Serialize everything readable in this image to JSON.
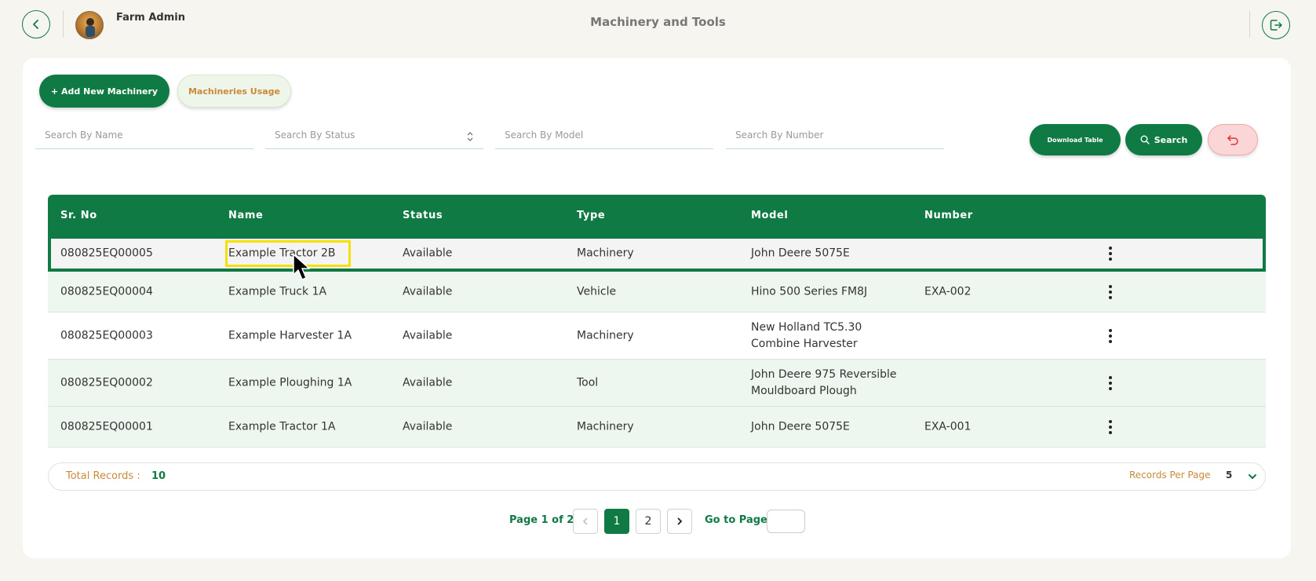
{
  "header": {
    "admin_name": "Farm Admin",
    "title": "Machinery and Tools",
    "back_icon": "chevron-left-icon",
    "logout_icon": "logout-icon"
  },
  "toolbar": {
    "add_label": "+ Add New Machinery",
    "usage_label": "Machineries Usage",
    "download_label": "Download Table",
    "search_label": "Search",
    "reset_icon": "undo-icon"
  },
  "filters": {
    "name_placeholder": "Search By Name",
    "status_placeholder": "Search By Status",
    "model_placeholder": "Search By Model",
    "number_placeholder": "Search By Number"
  },
  "table": {
    "headers": [
      "Sr. No",
      "Name",
      "Status",
      "Type",
      "Model",
      "Number"
    ],
    "rows": [
      {
        "sr": "080825EQ00005",
        "name": "Example Tractor 2B",
        "status": "Available",
        "type": "Machinery",
        "model": "John Deere 5075E",
        "number": ""
      },
      {
        "sr": "080825EQ00004",
        "name": "Example Truck 1A",
        "status": "Available",
        "type": "Vehicle",
        "model": "Hino 500 Series FM8J",
        "number": "EXA-002"
      },
      {
        "sr": "080825EQ00003",
        "name": "Example Harvester 1A",
        "status": "Available",
        "type": "Machinery",
        "model": "New Holland TC5.30 Combine Harvester",
        "number": ""
      },
      {
        "sr": "080825EQ00002",
        "name": "Example Ploughing 1A",
        "status": "Available",
        "type": "Tool",
        "model": "John Deere 975 Reversible Mouldboard Plough",
        "number": ""
      },
      {
        "sr": "080825EQ00001",
        "name": "Example Tractor 1A",
        "status": "Available",
        "type": "Machinery",
        "model": "John Deere 5075E",
        "number": "EXA-001"
      }
    ]
  },
  "footer": {
    "total_label": "Total Records :",
    "total_value": "10",
    "rpp_label": "Records Per Page",
    "rpp_value": "5"
  },
  "pager": {
    "label": "Page 1 of 2",
    "pages": [
      "1",
      "2"
    ],
    "goto_label": "Go to Page",
    "goto_value": ""
  },
  "colors": {
    "primary": "#0f7a43",
    "accent": "#c98a3a",
    "background": "#f6f5ef",
    "highlight": "#f5e000"
  }
}
